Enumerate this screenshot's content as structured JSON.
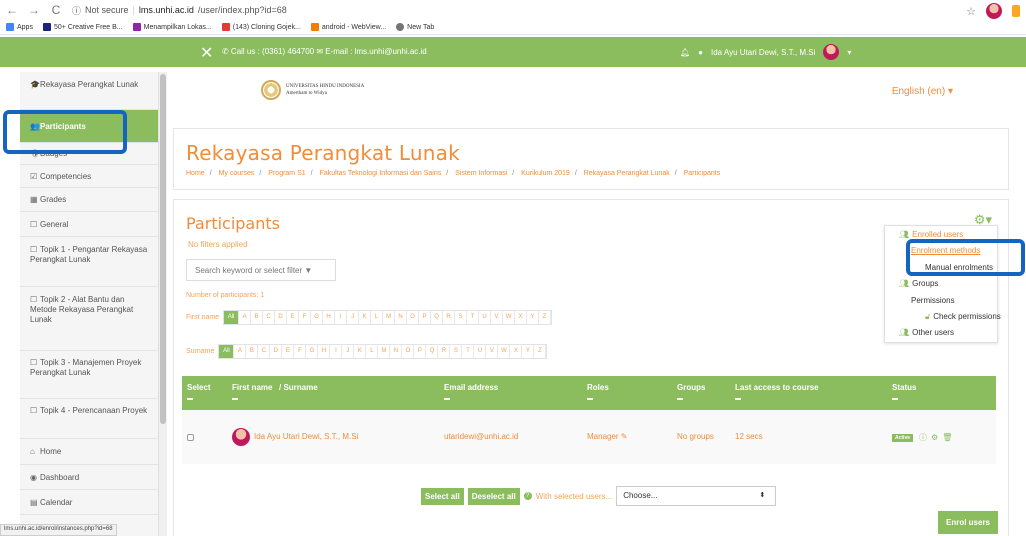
{
  "browser": {
    "back": "←",
    "forward": "→",
    "reload": "C",
    "security": "Not secure",
    "url_host": "lms.unhi.ac.id",
    "url_path": "/user/index.php?id=68",
    "bookmarks": [
      {
        "label": "Apps",
        "color": "#4285f4"
      },
      {
        "label": "50+ Creative Free B...",
        "color": "#1a237e"
      },
      {
        "label": "Menampilkan Lokas...",
        "color": "#8e24aa"
      },
      {
        "label": "(143) Cloning Gojek...",
        "color": "#e53935"
      },
      {
        "label": "android - WebView...",
        "color": "#f57c00"
      },
      {
        "label": "New Tab",
        "color": "#757575"
      }
    ]
  },
  "topnav": {
    "close": "✕",
    "contact": "✆ Call us : (0361) 464700 ✉ E-mail : lms.unhi@unhi.ac.id",
    "user_name": "Ida Ayu Utari Dewi, S.T., M.Si",
    "caret": "▾"
  },
  "header": {
    "logo_line1": "UNIVERSITAS HINDU INDONESIA",
    "logo_line2": "Amertham to Widya",
    "language": "English (en) ▾"
  },
  "sidebar": {
    "items": [
      {
        "icon": "🎓",
        "label": "Rekayasa Perangkat Lunak"
      },
      {
        "icon": "👥",
        "label": "Participants"
      },
      {
        "icon": "🛡",
        "label": "Badges"
      },
      {
        "icon": "☑",
        "label": "Competencies"
      },
      {
        "icon": "▦",
        "label": "Grades"
      },
      {
        "icon": "☐",
        "label": "General"
      },
      {
        "icon": "☐",
        "label": "Topik 1 - Pengantar Rekayasa Perangkat Lunak"
      },
      {
        "icon": "☐",
        "label": "Topik 2 - Alat Bantu dan Metode Rekayasa Perangkat Lunak"
      },
      {
        "icon": "☐",
        "label": "Topik 3 - Manajemen Proyek Perangkat Lunak"
      },
      {
        "icon": "☐",
        "label": "Topik 4 - Perencanaan Proyek"
      },
      {
        "icon": "⌂",
        "label": "Home"
      },
      {
        "icon": "◉",
        "label": "Dashboard"
      },
      {
        "icon": "▤",
        "label": "Calendar"
      }
    ]
  },
  "course": {
    "title": "Rekayasa Perangkat Lunak",
    "breadcrumbs": [
      "Home",
      "My courses",
      "Program S1",
      "Fakultas Teknologi Informasi dan Sains",
      "Sistem Informasi",
      "Kurikulum 2019",
      "Rekayasa Perangkat Lunak",
      "Participants"
    ]
  },
  "participants": {
    "title": "Participants",
    "filters": "No filters applied",
    "search_placeholder": "Search keyword or select filter ▼",
    "count_label": "Number of participants: 1",
    "firstname_label": "First name",
    "surname_label": "Surname",
    "all_label": "All",
    "letters": [
      "A",
      "B",
      "C",
      "D",
      "E",
      "F",
      "G",
      "H",
      "I",
      "J",
      "K",
      "L",
      "M",
      "N",
      "O",
      "P",
      "Q",
      "R",
      "S",
      "T",
      "U",
      "V",
      "W",
      "X",
      "Y",
      "Z"
    ]
  },
  "table": {
    "headers": [
      "Select",
      "First name",
      "/ Surname",
      "Email address",
      "Roles",
      "Groups",
      "Last access to course",
      "Status"
    ],
    "rows": [
      {
        "name": "Ida Ayu Utari Dewi, S.T., M.Si",
        "email": "utaridewi@unhi.ac.id",
        "role": "Manager ✎",
        "groups": "No groups",
        "last_access": "12 secs",
        "status": "Active"
      }
    ]
  },
  "bulk": {
    "select_all": "Select all",
    "deselect_all": "Deselect all",
    "help": "?",
    "with_selected": "With selected users...",
    "choose": "Choose...",
    "choose_arrow": "⬍",
    "enrol_users": "Enrol users"
  },
  "menu": {
    "gear": "⚙▾",
    "enrolled_users": "Enrolled users",
    "enrolment_methods": "Enrolment methods",
    "manual_enrolments": "Manual enrolments",
    "groups": "Groups",
    "permissions": "Permissions",
    "check_permissions": "Check permissions",
    "other_users": "Other users"
  },
  "statusbar": "lms.unhi.ac.id/enrol/instances.php?id=68",
  "colors": {
    "accent_green": "#8bbd5e",
    "accent_orange": "#f28c38",
    "highlight_blue": "#1565c0"
  }
}
